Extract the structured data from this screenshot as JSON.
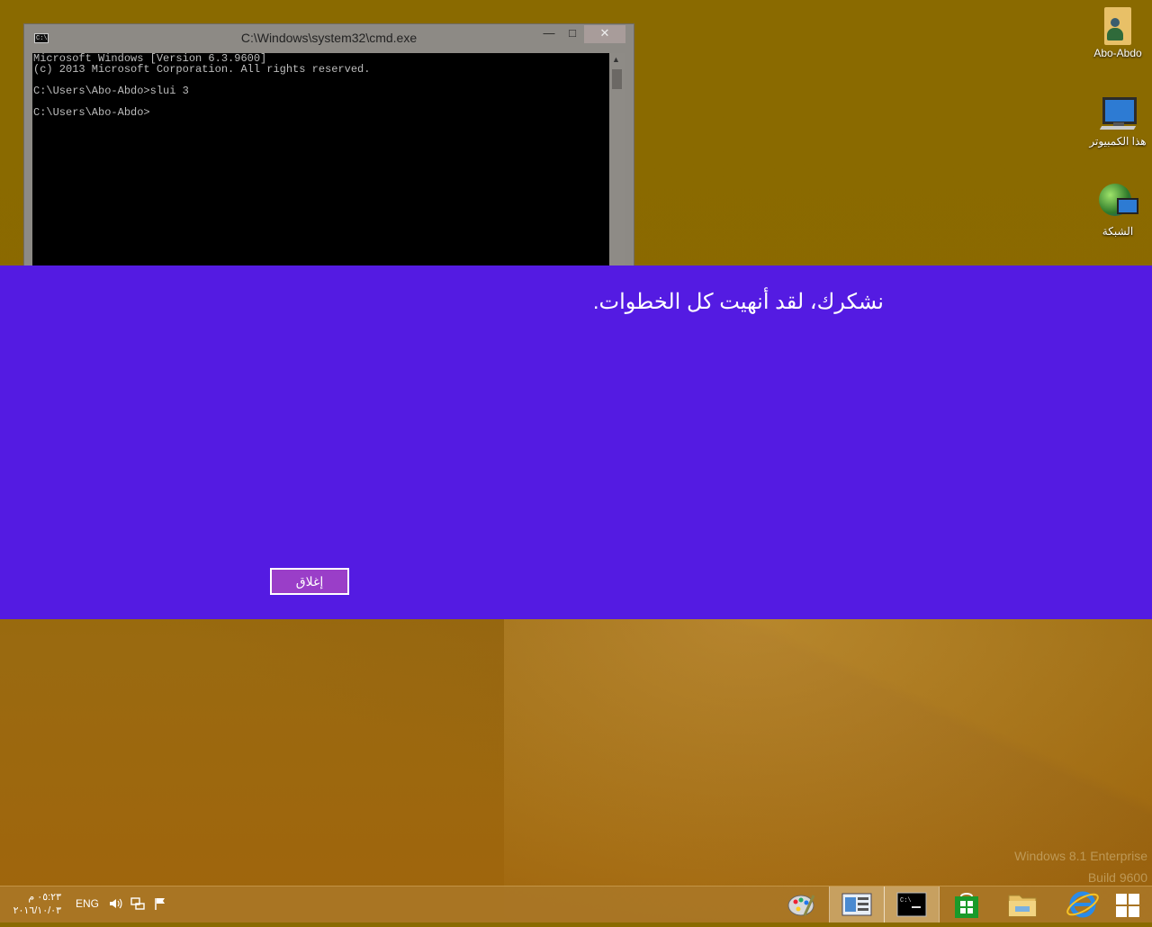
{
  "cmd": {
    "title": "C:\\Windows\\system32\\cmd.exe",
    "icon_text": "C:\\",
    "minimize": "—",
    "maximize": "□",
    "close": "✕",
    "lines": [
      "Microsoft Windows [Version 6.3.9600]",
      "(c) 2013 Microsoft Corporation. All rights reserved.",
      "",
      "C:\\Users\\Abo-Abdo>slui 3",
      "",
      "C:\\Users\\Abo-Abdo>"
    ]
  },
  "desktop_icons": [
    {
      "label": "Abo-Abdo",
      "icon": "user-folder-icon"
    },
    {
      "label": "هذا الكمبيوتر",
      "icon": "computer-icon"
    },
    {
      "label": "الشبكة",
      "icon": "network-icon"
    }
  ],
  "activation": {
    "message": "نشكرك، لقد أنهيت كل الخطوات.",
    "close_button": "إغلاق",
    "background": "#541be2"
  },
  "watermark": {
    "line1": "Windows 8.1 Enterprise",
    "line2": "Build 9600"
  },
  "taskbar": {
    "clock_time": "٠٥:٢٣ م",
    "clock_date": "٢٠١٦/١٠/٠٣",
    "language": "ENG",
    "tray_icons": [
      "volume-icon",
      "network-tray-icon",
      "action-center-flag-icon"
    ],
    "pinned": [
      "paint-icon",
      "control-panel-icon",
      "cmd-icon",
      "store-icon",
      "file-explorer-icon",
      "internet-explorer-icon",
      "start-icon"
    ]
  }
}
